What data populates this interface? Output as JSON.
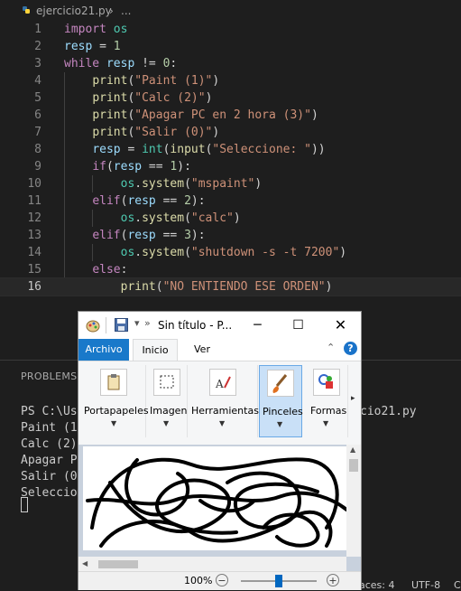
{
  "editor": {
    "breadcrumb": {
      "file": "ejercicio21.py",
      "sep": "›",
      "more": "..."
    },
    "lines": [
      {
        "n": "1",
        "tokens": [
          [
            "kw",
            "import"
          ],
          [
            "op",
            " "
          ],
          [
            "mod",
            "os"
          ]
        ]
      },
      {
        "n": "2",
        "tokens": [
          [
            "var",
            "resp"
          ],
          [
            "op",
            " = "
          ],
          [
            "num",
            "1"
          ]
        ]
      },
      {
        "n": "3",
        "tokens": [
          [
            "kw",
            "while"
          ],
          [
            "op",
            " "
          ],
          [
            "var",
            "resp"
          ],
          [
            "op",
            " != "
          ],
          [
            "num",
            "0"
          ],
          [
            "op",
            ":"
          ]
        ]
      },
      {
        "n": "4",
        "tokens": [
          [
            "op",
            "    "
          ],
          [
            "fn",
            "print"
          ],
          [
            "op",
            "("
          ],
          [
            "str",
            "\"Paint (1)\""
          ],
          [
            "op",
            ")"
          ]
        ]
      },
      {
        "n": "5",
        "tokens": [
          [
            "op",
            "    "
          ],
          [
            "fn",
            "print"
          ],
          [
            "op",
            "("
          ],
          [
            "str",
            "\"Calc (2)\""
          ],
          [
            "op",
            ")"
          ]
        ]
      },
      {
        "n": "6",
        "tokens": [
          [
            "op",
            "    "
          ],
          [
            "fn",
            "print"
          ],
          [
            "op",
            "("
          ],
          [
            "str",
            "\"Apagar PC en 2 hora (3)\""
          ],
          [
            "op",
            ")"
          ]
        ]
      },
      {
        "n": "7",
        "tokens": [
          [
            "op",
            "    "
          ],
          [
            "fn",
            "print"
          ],
          [
            "op",
            "("
          ],
          [
            "str",
            "\"Salir (0)\""
          ],
          [
            "op",
            ")"
          ]
        ]
      },
      {
        "n": "8",
        "tokens": [
          [
            "op",
            "    "
          ],
          [
            "var",
            "resp"
          ],
          [
            "op",
            " = "
          ],
          [
            "mod",
            "int"
          ],
          [
            "op",
            "("
          ],
          [
            "fn",
            "input"
          ],
          [
            "op",
            "("
          ],
          [
            "str",
            "\"Seleccione: \""
          ],
          [
            "op",
            "))"
          ]
        ]
      },
      {
        "n": "9",
        "tokens": [
          [
            "op",
            "    "
          ],
          [
            "kw",
            "if"
          ],
          [
            "op",
            "("
          ],
          [
            "var",
            "resp"
          ],
          [
            "op",
            " == "
          ],
          [
            "num",
            "1"
          ],
          [
            "op",
            "):"
          ]
        ]
      },
      {
        "n": "10",
        "tokens": [
          [
            "op",
            "        "
          ],
          [
            "mod",
            "os"
          ],
          [
            "op",
            "."
          ],
          [
            "fn",
            "system"
          ],
          [
            "op",
            "("
          ],
          [
            "str",
            "\"mspaint\""
          ],
          [
            "op",
            ")"
          ]
        ]
      },
      {
        "n": "11",
        "tokens": [
          [
            "op",
            "    "
          ],
          [
            "kw",
            "elif"
          ],
          [
            "op",
            "("
          ],
          [
            "var",
            "resp"
          ],
          [
            "op",
            " == "
          ],
          [
            "num",
            "2"
          ],
          [
            "op",
            "):"
          ]
        ]
      },
      {
        "n": "12",
        "tokens": [
          [
            "op",
            "        "
          ],
          [
            "mod",
            "os"
          ],
          [
            "op",
            "."
          ],
          [
            "fn",
            "system"
          ],
          [
            "op",
            "("
          ],
          [
            "str",
            "\"calc\""
          ],
          [
            "op",
            ")"
          ]
        ]
      },
      {
        "n": "13",
        "tokens": [
          [
            "op",
            "    "
          ],
          [
            "kw",
            "elif"
          ],
          [
            "op",
            "("
          ],
          [
            "var",
            "resp"
          ],
          [
            "op",
            " == "
          ],
          [
            "num",
            "3"
          ],
          [
            "op",
            "):"
          ]
        ]
      },
      {
        "n": "14",
        "tokens": [
          [
            "op",
            "        "
          ],
          [
            "mod",
            "os"
          ],
          [
            "op",
            "."
          ],
          [
            "fn",
            "system"
          ],
          [
            "op",
            "("
          ],
          [
            "str",
            "\"shutdown -s -t 7200\""
          ],
          [
            "op",
            ")"
          ]
        ]
      },
      {
        "n": "15",
        "tokens": [
          [
            "op",
            "    "
          ],
          [
            "kw",
            "else"
          ],
          [
            "op",
            ":"
          ]
        ]
      },
      {
        "n": "16",
        "tokens": [
          [
            "op",
            "        "
          ],
          [
            "fn",
            "print"
          ],
          [
            "op",
            "("
          ],
          [
            "str",
            "\"NO ENTIENDO ESE ORDEN\""
          ],
          [
            "op",
            ")"
          ]
        ]
      }
    ],
    "active_line": 16
  },
  "panel": {
    "tab": "PROBLEMS",
    "terminal": [
      "PS C:\\Use",
      "Paint (1)",
      "Calc (2)",
      "Apagar PC",
      "Salir (0)",
      "Seleccion"
    ],
    "terminal_right": "cio21.py"
  },
  "statusbar": {
    "spaces": "Spaces: 4",
    "encoding": "UTF-8",
    "extra": "C"
  },
  "paint": {
    "title": "Sin título - P...",
    "qat_more": "»",
    "tabs": {
      "archivo": "Archivo",
      "inicio": "Inicio",
      "ver": "Ver"
    },
    "groups": [
      {
        "label": "Portapapeles",
        "icon": "clipboard-icon"
      },
      {
        "label": "Imagen",
        "icon": "select-icon"
      },
      {
        "label": "Herramientas",
        "icon": "tools-icon"
      },
      {
        "label": "Pinceles",
        "icon": "brush-icon"
      },
      {
        "label": "Formas",
        "icon": "shapes-icon"
      }
    ],
    "zoom": "100%",
    "zoom_level_fraction": 0.5,
    "colors": {
      "accent": "#1979ca",
      "selected": "#c9e0f7"
    }
  }
}
